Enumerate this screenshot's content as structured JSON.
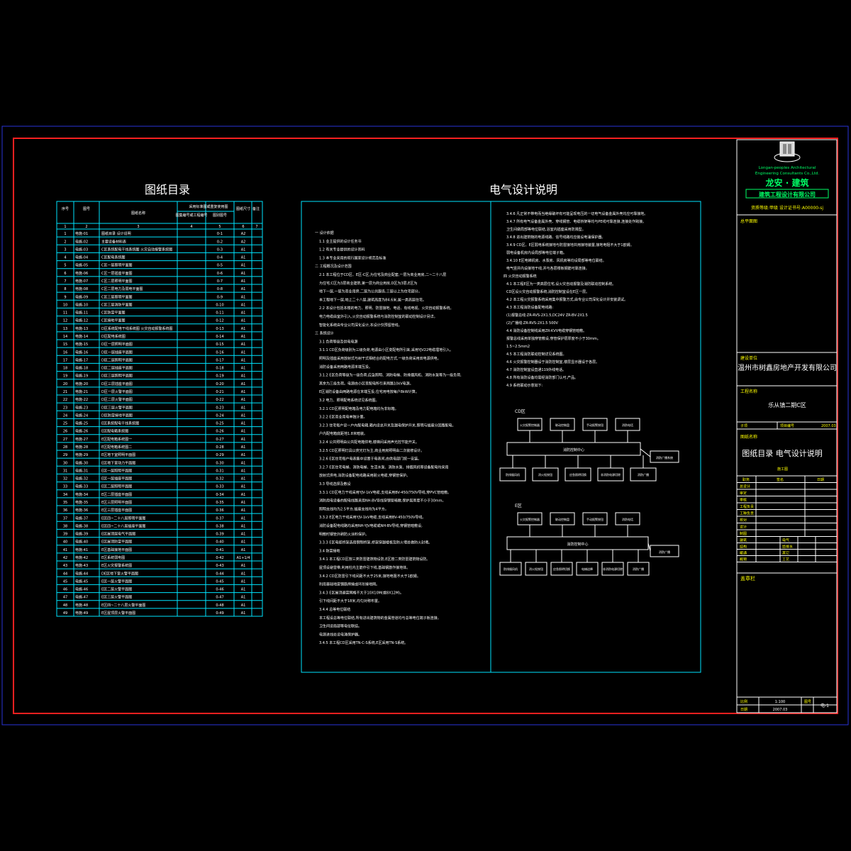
{
  "colors": {
    "background": "#000000",
    "outer_frame": "#2a33d8",
    "inner_frame": "#ff2020",
    "table_lines": "#00e5ff",
    "text": "#ffffff",
    "highlight": "#ffff00",
    "logo_green": "#00ff66"
  },
  "catalog": {
    "title": "图纸目录",
    "header": {
      "col_seq": "序号",
      "col_drawing_no": "图号",
      "col_name": "图纸名称",
      "col_std_group": "采用标准图或重复使用图",
      "col_std_name": "图集编号或工程编号",
      "col_std_no": "图别图号",
      "col_size": "图纸尺寸",
      "col_note": "备注",
      "col_index": [
        "1",
        "2",
        "3",
        "4",
        "5",
        "6",
        "7"
      ]
    },
    "rows": [
      {
        "n": "1",
        "no": "电施-01",
        "name": "图纸目录  设计说明",
        "ref": "0-1",
        "size": "A2"
      },
      {
        "n": "2",
        "no": "电施-02",
        "name": "主要设备材料表",
        "ref": "0-2",
        "size": "A2"
      },
      {
        "n": "3",
        "no": "电施-03",
        "name": "C区系统配电干线系统图  火灾自动报警系统图",
        "ref": "0-3",
        "size": "A1"
      },
      {
        "n": "4",
        "no": "电施-04",
        "name": "C区配电系统图",
        "ref": "0-4",
        "size": "A1"
      },
      {
        "n": "5",
        "no": "电施-05",
        "name": "C区一层照明平面图",
        "ref": "0-5",
        "size": "A1"
      },
      {
        "n": "6",
        "no": "电施-06",
        "name": "C区一层插座平面图",
        "ref": "0-6",
        "size": "A1"
      },
      {
        "n": "7",
        "no": "电施-07",
        "name": "C区二层照明平面图",
        "ref": "0-7",
        "size": "A1"
      },
      {
        "n": "8",
        "no": "电施-08",
        "name": "C区二层电力及弱电平面图",
        "ref": "0-8",
        "size": "A1"
      },
      {
        "n": "9",
        "no": "电施-09",
        "name": "C区三层照明平面图",
        "ref": "0-9",
        "size": "A1"
      },
      {
        "n": "10",
        "no": "电施-10",
        "name": "C区三层消防平面图",
        "ref": "0-10",
        "size": "A1"
      },
      {
        "n": "11",
        "no": "电施-11",
        "name": "C区防雷平面图",
        "ref": "0-11",
        "size": "A1"
      },
      {
        "n": "12",
        "no": "电施-12",
        "name": "C区接地平面图",
        "ref": "0-12",
        "size": "A1"
      },
      {
        "n": "13",
        "no": "电施-13",
        "name": "D区系统配电干线系统图  火灾自动报警系统图",
        "ref": "0-13",
        "size": "A1"
      },
      {
        "n": "14",
        "no": "电施-14",
        "name": "D区配电系统图",
        "ref": "0-14",
        "size": "A1"
      },
      {
        "n": "15",
        "no": "电施-15",
        "name": "D区一层照明平面图",
        "ref": "0-15",
        "size": "A1"
      },
      {
        "n": "16",
        "no": "电施-16",
        "name": "D区一层插座平面图",
        "ref": "0-16",
        "size": "A1"
      },
      {
        "n": "17",
        "no": "电施-17",
        "name": "D区二层照明平面图",
        "ref": "0-17",
        "size": "A1"
      },
      {
        "n": "18",
        "no": "电施-18",
        "name": "D区二层插座平面图",
        "ref": "0-18",
        "size": "A1"
      },
      {
        "n": "19",
        "no": "电施-19",
        "name": "D区三层照明平面图",
        "ref": "0-19",
        "size": "A1"
      },
      {
        "n": "20",
        "no": "电施-20",
        "name": "D区三层插座平面图",
        "ref": "0-20",
        "size": "A1"
      },
      {
        "n": "21",
        "no": "电施-21",
        "name": "D区一层火警平面图",
        "ref": "0-21",
        "size": "A1"
      },
      {
        "n": "22",
        "no": "电施-22",
        "name": "D区二层火警平面图",
        "ref": "0-22",
        "size": "A1"
      },
      {
        "n": "23",
        "no": "电施-23",
        "name": "D区三层火警平面图",
        "ref": "0-23",
        "size": "A1"
      },
      {
        "n": "24",
        "no": "电施-24",
        "name": "D区防雷接地平面图",
        "ref": "0-24",
        "size": "A1"
      },
      {
        "n": "25",
        "no": "电施-25",
        "name": "E区系统配电干线系统图",
        "ref": "0-25",
        "size": "A1"
      },
      {
        "n": "26",
        "no": "电施-26",
        "name": "E区配电箱系统图",
        "ref": "0-26",
        "size": "A1"
      },
      {
        "n": "27",
        "no": "电施-27",
        "name": "E区配电箱系统图一",
        "ref": "0-27",
        "size": "A1"
      },
      {
        "n": "28",
        "no": "电施-28",
        "name": "E区配电箱系统图二",
        "ref": "0-28",
        "size": "A1"
      },
      {
        "n": "29",
        "no": "电施-29",
        "name": "E区地下室照明平面图",
        "ref": "0-29",
        "size": "A1"
      },
      {
        "n": "30",
        "no": "电施-30",
        "name": "E区地下室动力平面图",
        "ref": "0-30",
        "size": "A1"
      },
      {
        "n": "31",
        "no": "电施-31",
        "name": "E区一层照明平面图",
        "ref": "0-31",
        "size": "A1"
      },
      {
        "n": "32",
        "no": "电施-32",
        "name": "E区一层插座平面图",
        "ref": "0-32",
        "size": "A1"
      },
      {
        "n": "33",
        "no": "电施-33",
        "name": "E区二层照明平面图",
        "ref": "0-33",
        "size": "A1"
      },
      {
        "n": "34",
        "no": "电施-34",
        "name": "E区二层插座平面图",
        "ref": "0-34",
        "size": "A1"
      },
      {
        "n": "35",
        "no": "电施-35",
        "name": "E区三层照明平面图",
        "ref": "0-35",
        "size": "A1"
      },
      {
        "n": "36",
        "no": "电施-36",
        "name": "E区三层插座平面图",
        "ref": "0-36",
        "size": "A1"
      },
      {
        "n": "37",
        "no": "电施-37",
        "name": "E区四~二十八层照明平面图",
        "ref": "0-37",
        "size": "A1"
      },
      {
        "n": "38",
        "no": "电施-38",
        "name": "E区四~二十八层插座平面图",
        "ref": "0-38",
        "size": "A1"
      },
      {
        "n": "39",
        "no": "电施-39",
        "name": "E区屋顶层电气平面图",
        "ref": "0-39",
        "size": "A1"
      },
      {
        "n": "40",
        "no": "电施-40",
        "name": "E区屋顶防雷平面图",
        "ref": "0-40",
        "size": "A1"
      },
      {
        "n": "41",
        "no": "电施-41",
        "name": "E区基础接地平面图",
        "ref": "0-41",
        "size": "A1"
      },
      {
        "n": "42",
        "no": "电施-42",
        "name": "E区系统弱电图",
        "ref": "0-42",
        "size": "A1+1/4"
      },
      {
        "n": "43",
        "no": "电施-43",
        "name": "E区火灾报警系统图",
        "ref": "0-43",
        "size": "A1"
      },
      {
        "n": "44",
        "no": "电施-44",
        "name": "DE区地下室火警平面图",
        "ref": "0-44",
        "size": "A1"
      },
      {
        "n": "45",
        "no": "电施-45",
        "name": "E区一层火警平面图",
        "ref": "0-45",
        "size": "A1"
      },
      {
        "n": "46",
        "no": "电施-46",
        "name": "E区二层火警平面图",
        "ref": "0-46",
        "size": "A1"
      },
      {
        "n": "47",
        "no": "电施-47",
        "name": "E区三层火警平面图",
        "ref": "0-47",
        "size": "A1"
      },
      {
        "n": "48",
        "no": "电施-48",
        "name": "E区四~二十八层火警平面图",
        "ref": "0-48",
        "size": "A1"
      },
      {
        "n": "49",
        "no": "电施-49",
        "name": "E区屋顶层火警平面图",
        "ref": "0-49",
        "size": "A1"
      }
    ]
  },
  "spec": {
    "title": "电气设计说明",
    "left_lines": [
      {
        "k": "h",
        "t": "一  设计依据"
      },
      {
        "k": "p",
        "t": "1.1   业主提供的设计任务书"
      },
      {
        "k": "p",
        "t": "1.2   有关专业提供的设计资料"
      },
      {
        "k": "p",
        "t": "1.3   本专业采用的现行国家设计规范及标准"
      },
      {
        "k": "h",
        "t": "二  工程概况及设计范围"
      },
      {
        "k": "p",
        "t": "2.1   本工程位于CD区、E区-C区,为住宅及商业配套,一层为商业用房,二~二十八层"
      },
      {
        "k": "p",
        "t": "      为住宅;C区为3层商业建筑,第一层为商业用房,D区为3层,E区为"
      },
      {
        "k": "p",
        "t": "      地下一层,一层为商业用房,二层为公共服务,三层以上为住宅部分。"
      },
      {
        "k": "p",
        "t": "      本工程地下一层,地上二十八层,建筑高度为84.6米,属一类高层住宅。"
      },
      {
        "k": "p",
        "t": "2.2   本设计包括本楼的电力、照明、防雷接地、电话、有线电视、火灾自动报警系统。"
      },
      {
        "k": "p",
        "t": "      电力电缆由室外引入,火灾自动报警系统与消防控制室的联动控制设计另详。"
      },
      {
        "k": "p",
        "t": "      智能化系统由专业公司深化设计,本设计仅预留管线。"
      },
      {
        "k": "h",
        "t": "三  系统设计"
      },
      {
        "k": "p",
        "t": "3.1   负荷等级及供电电源"
      },
      {
        "k": "p",
        "t": "3.1.1 CD区负荷级别为三级负荷,电源由小区变配电所引来,采用YJV22电缆埋地引入。"
      },
      {
        "k": "p",
        "t": "      照明及插座采用放射式与树干式相结合的配电方式,一级负荷采用双电源供电。"
      },
      {
        "k": "p",
        "t": "      消防设备采用两路电源末端互投。"
      },
      {
        "k": "p",
        "t": "3.1.2 E区负荷等级为一级负荷,应急照明、消防电梯、防排烟风机、消防水泵等为一级负荷,"
      },
      {
        "k": "p",
        "t": "      其余为三级负荷。电源由小区变配电所引来两路10kV电源。"
      },
      {
        "k": "p",
        "t": "      E区消防设备由两路电源在末端互投,住宅用电按每户8kW计算。"
      },
      {
        "k": "p",
        "t": "3.2   电力、照明配电系统详见系统图。"
      },
      {
        "k": "p",
        "t": "3.2.1 CD区照明配电箱及电力配电箱均为非标箱。"
      },
      {
        "k": "p",
        "t": "3.2.2 E区商业用电单独计量。"
      },
      {
        "k": "p",
        "t": "3.2.3 住宅每户设一户内配电箱,箱内设总开关及漏电保护开关,照明与插座分回路配电。"
      },
      {
        "k": "p",
        "t": "      户内配电箱底距地1.8米暗装。"
      },
      {
        "k": "p",
        "t": "3.2.4 公共照明由公共配电箱供电,楼梯间采用声光控节能开关。"
      },
      {
        "k": "p",
        "t": "3.2.5 CD区照明灯具以荧光灯为主,商业用房照明由二次装修设计。"
      },
      {
        "k": "p",
        "t": "3.2.6 E区住宅每户电表集中设置于电表间,由供电部门统一安装。"
      },
      {
        "k": "p",
        "t": "3.2.7 E区住宅电梯、消防电梯、生活水泵、消防水泵、排烟风机等设备配电均采用"
      },
      {
        "k": "p",
        "t": "      放射式供电,消防设备配电线路采用耐火电缆,穿钢管保护。"
      },
      {
        "k": "p",
        "t": "3.3   导线选择及敷设"
      },
      {
        "k": "p",
        "t": "3.3.1 CD区电力干线采用YJV-1kV电缆,支线采用BV-450/750V导线,穿PVC管暗敷。"
      },
      {
        "k": "p",
        "t": "      消防用电设备的配电线路采用NH-BV导线穿钢管暗敷,保护层厚度不小于30mm。"
      },
      {
        "k": "p",
        "t": "      照明支线均为2.5平方,插座支线均为4平方。"
      },
      {
        "k": "p",
        "t": "3.3.2 E区电力干线采用YJV-1kV电缆,支线采用BV-450/750V导线。"
      },
      {
        "k": "p",
        "t": "      消防设备配电线路均采用NH-YJV电缆或NH-BV导线,穿钢管暗敷设,"
      },
      {
        "k": "p",
        "t": "      明敷时钢管外刷防火涂料保护。"
      },
      {
        "k": "p",
        "t": "3.3.3 E区电缆桥架选用钢制桥架,桥架穿越楼板及防火墙处做防火封堵。"
      },
      {
        "k": "p",
        "t": "3.4   防雷接地"
      },
      {
        "k": "p",
        "t": "3.4.1 本工程CD区按三类防雷建筑物设防,E区按二类防雷建筑物设防。"
      },
      {
        "k": "p",
        "t": "      屋顶设避雷带,利用柱内主筋作引下线,基础钢筋作接地体。"
      },
      {
        "k": "p",
        "t": "3.4.2 CD区防雷引下线间距不大于25米,接地电阻不大于1欧姆。"
      },
      {
        "k": "p",
        "t": "      利用基础地梁钢筋焊接成环形接地网。"
      },
      {
        "k": "p",
        "t": "3.4.3 E区屋顶避雷网格不大于10X10M(或8X12M)。"
      },
      {
        "k": "p",
        "t": "      引下线间距不大于18米,均匀对称布置。"
      },
      {
        "k": "p",
        "t": "3.4.4 总等电位联结"
      },
      {
        "k": "p",
        "t": "      本工程设总等电位联结,所有进出建筑物的金属管道均与总等电位端子板连接。"
      },
      {
        "k": "p",
        "t": "      卫生间设局部等电位联结。"
      },
      {
        "k": "p",
        "t": "      电源进线处设电涌保护器。"
      },
      {
        "k": "p",
        "t": "3.4.5 本工程CD区采用TN-C-S系统,E区采用TN-S系统。"
      }
    ],
    "right_lines": [
      {
        "k": "p",
        "t": "3.4.6 凡正常不带电而当绝缘破坏有可能呈现电压的一切电气设备金属外壳均应可靠接地。"
      },
      {
        "k": "p",
        "t": "3.4.7 所有电气设备金属外壳、穿线钢管、电缆桥架等均与PE线可靠连接,连接处作跨接。"
      },
      {
        "k": "p",
        "t": "      卫生间做局部等电位联结,浴室内插座采用防溅型。"
      },
      {
        "k": "p",
        "t": "3.4.8 进出建筑物的电源线路、信号线路均应装设电涌保护器。"
      },
      {
        "k": "p",
        "t": "3.4.9 CD区、E区弱电系统接地与防雷接地共用接地装置,接地电阻不大于1欧姆。"
      },
      {
        "k": "p",
        "t": "      弱电设备机房内设局部等电位端子箱。"
      },
      {
        "k": "p",
        "t": "3.4.10 E区电梯机房、水泵房、风机房等均设局部等电位联结。"
      },
      {
        "k": "p",
        "t": "      电气竖井内设接地干线,并与各层楼板钢筋可靠连接。"
      },
      {
        "k": "h",
        "t": "四  火灾自动报警系统"
      },
      {
        "k": "p",
        "t": "4.1   本工程E区为一类高层住宅,设火灾自动报警及消防联动控制系统。"
      },
      {
        "k": "p",
        "t": "      CD区设火灾自动报警系统,消防控制室设在E区一层。"
      },
      {
        "k": "p",
        "t": "4.2   本工程火灾报警系统采用集中报警方式,由专业公司深化设计并安装调试。"
      },
      {
        "k": "p",
        "t": "4.3   本工程消防设备配电线路:"
      },
      {
        "k": "p",
        "t": "      (1)报警总线:ZR-RVS-2X1.5,DC24V   ZR-BV-2X1.5"
      },
      {
        "k": "p",
        "t": "      (2)广播线:ZR-RVS-2X1.5      500V"
      },
      {
        "k": "p",
        "t": "4.4   消防设备控制线采用ZR-KVV电缆穿钢管暗敷。"
      },
      {
        "k": "p",
        "t": "      报警总线采用单独穿管敷设,穿管保护层厚度不小于30mm。"
      },
      {
        "k": "p",
        "t": "      1.5~2.5mm2"
      },
      {
        "k": "p",
        "t": "4.5   本工程消防联动控制详见系统图。"
      },
      {
        "k": "p",
        "t": "4.6   火灾报警控制器设于消防控制室,楼层显示器设于各层。"
      },
      {
        "k": "p",
        "t": "4.7   消防控制室设直通119外线电话。"
      },
      {
        "k": "p",
        "t": "4.8   所有消防设备均需经消防部门认可,产品。"
      },
      {
        "k": "p",
        "t": "4.9   系统联动示意如下:"
      }
    ],
    "flow1_label": "CD区",
    "flow1_top": [
      "火灾报警控制器",
      "联动控制盘",
      "手动报警按钮",
      "消防电话"
    ],
    "flow1_bus": "消防控制中心",
    "flow1_bottom": [
      "防排烟风机",
      "消火栓按钮",
      "应急照明切换",
      "非消防电源切除",
      "消防广播"
    ],
    "flow1_side": "消防广播系统",
    "flow2_label": "E区",
    "flow2_top": [
      "火灾报警控制器",
      "联动控制盘",
      "手动报警按钮",
      "消防电话"
    ],
    "flow2_bus": "消防控制中心",
    "flow2_bottom": [
      "防排烟风机",
      "消火栓按钮",
      "应急照明切换",
      "电梯迫降",
      "非消防电源切除",
      "消防广播"
    ],
    "flow2_side": "消防广播"
  },
  "title_block": {
    "company_en_1": "Longan-peoples Architectural",
    "company_en_2": "Engineering Consultants Co.,Ltd.",
    "company_cn_logo": "龙安 · 建筑",
    "company_cn_full": "建筑工程设计有限公司",
    "cert_line": "资质等级:甲级   设计证书号:A00000-sj",
    "sign_header": "总平面图",
    "client_label": "建设单位",
    "client": "温州市树鑫房地产开发有限公司",
    "project_label": "工程名称",
    "project": "乐从镇二期C区",
    "sub_label_1": "子项",
    "sub_label_2": "项目编号",
    "sub_value": "2007.03",
    "drawing_label": "图纸名称",
    "drawing_title": "图纸目录  电气设计说明",
    "stage": "施工图",
    "role_header": [
      "职务",
      "签名",
      "日期"
    ],
    "roles": [
      "总设计",
      "审定",
      "审核",
      "工程负责",
      "工种负责",
      "校对",
      "设计",
      "制图"
    ],
    "disc_rows": [
      {
        "a": "建筑",
        "b": "电气"
      },
      {
        "a": "结构",
        "b": "给排水"
      },
      {
        "a": "暖通",
        "b": "其它"
      },
      {
        "a": "概预",
        "b": "工艺"
      }
    ],
    "seal_label": "盖章栏",
    "bottom": {
      "scale_label": "比例",
      "scale_value": "1:100",
      "date_label": "日期",
      "date_value": "2007.03",
      "sheet_label": "图号",
      "sheet_value": "电-1"
    }
  }
}
